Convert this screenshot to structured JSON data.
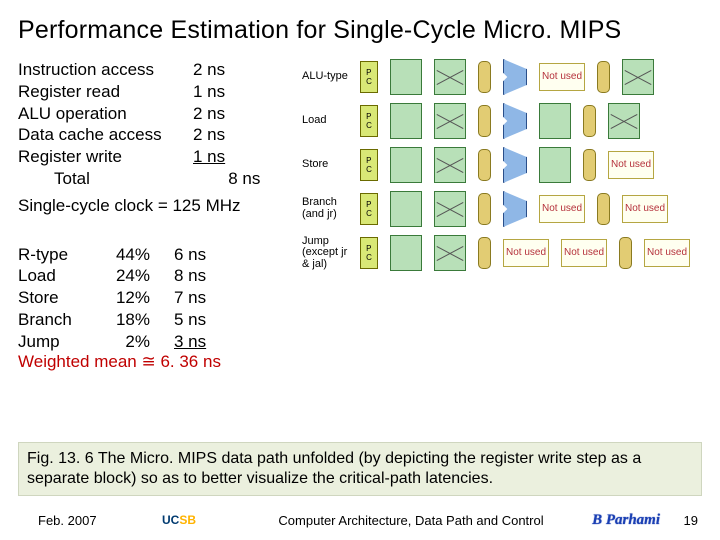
{
  "title": "Performance Estimation for Single-Cycle Micro. MIPS",
  "latencies": {
    "rows": [
      {
        "name": "Instruction access",
        "val": "2 ns",
        "u": false
      },
      {
        "name": "Register read",
        "val": "1 ns",
        "u": false
      },
      {
        "name": "ALU operation",
        "val": "2 ns",
        "u": false
      },
      {
        "name": "Data cache access",
        "val": "2 ns",
        "u": false
      },
      {
        "name": "Register write",
        "val": "1 ns",
        "u": true
      }
    ],
    "total_label": "Total",
    "total_val": "8 ns",
    "single_cycle": "Single-cycle clock = 125 MHz"
  },
  "mix": {
    "rows": [
      {
        "name": "R-type",
        "pct": "44%",
        "lat": "6 ns",
        "u": false
      },
      {
        "name": "Load",
        "pct": "24%",
        "lat": "8 ns",
        "u": false
      },
      {
        "name": "Store",
        "pct": "12%",
        "lat": "7 ns",
        "u": false
      },
      {
        "name": "Branch",
        "pct": "18%",
        "lat": "5 ns",
        "u": false
      },
      {
        "name": "Jump",
        "pct": "2%",
        "lat": "3 ns",
        "u": true
      }
    ],
    "weighted": "Weighted mean ≅ 6. 36 ns"
  },
  "diagram": {
    "pc": "P\nC",
    "not_used": "Not used",
    "rows": [
      {
        "label": "ALU-type",
        "nu_mem": false,
        "nu_alu": false,
        "nu_dm": true,
        "nu_wb": false
      },
      {
        "label": "Load",
        "nu_mem": false,
        "nu_alu": false,
        "nu_dm": false,
        "nu_wb": false
      },
      {
        "label": "Store",
        "nu_mem": false,
        "nu_alu": false,
        "nu_dm": false,
        "nu_wb": true
      },
      {
        "label": "Branch (and jr)",
        "nu_mem": false,
        "nu_alu": false,
        "nu_dm": true,
        "nu_wb": true
      },
      {
        "label": "Jump (except jr & jal)",
        "nu_mem": false,
        "nu_alu": true,
        "nu_dm": true,
        "nu_wb": true
      }
    ]
  },
  "caption": "Fig. 13. 6    The Micro. MIPS data path unfolded (by depicting the register write step as a separate block) so as to better visualize the critical-path latencies.",
  "footer": {
    "date": "Feb. 2007",
    "mid": "Computer Architecture, Data Path and Control",
    "author": "B Parhami",
    "page": "19",
    "logo_u": "UC",
    "logo_s": "SB"
  }
}
